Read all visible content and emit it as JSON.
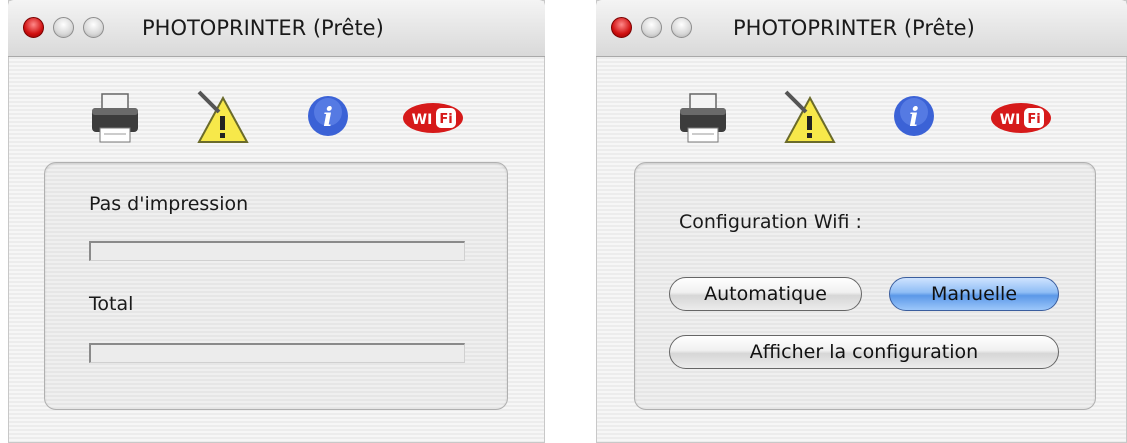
{
  "colors": {
    "close": "#d01010",
    "accent_button": "#5b98e8",
    "info_icon": "#3b62d6",
    "wifi_icon": "#d61a1a"
  },
  "left_window": {
    "title": "PHOTOPRINTER (Prête)",
    "toolbar_icons": [
      "printer-icon",
      "maintenance-warning-icon",
      "info-icon",
      "wifi-icon"
    ],
    "pages_label": "Pas d'impression",
    "pages_progress": 0,
    "total_label": "Total",
    "total_progress": 0
  },
  "right_window": {
    "title": "PHOTOPRINTER (Prête)",
    "toolbar_icons": [
      "printer-icon",
      "maintenance-warning-icon",
      "info-icon",
      "wifi-icon"
    ],
    "wifi_label": "Configuration Wifi :",
    "auto_button": "Automatique",
    "manual_button": "Manuelle",
    "show_config_button": "Afficher la configuration"
  }
}
